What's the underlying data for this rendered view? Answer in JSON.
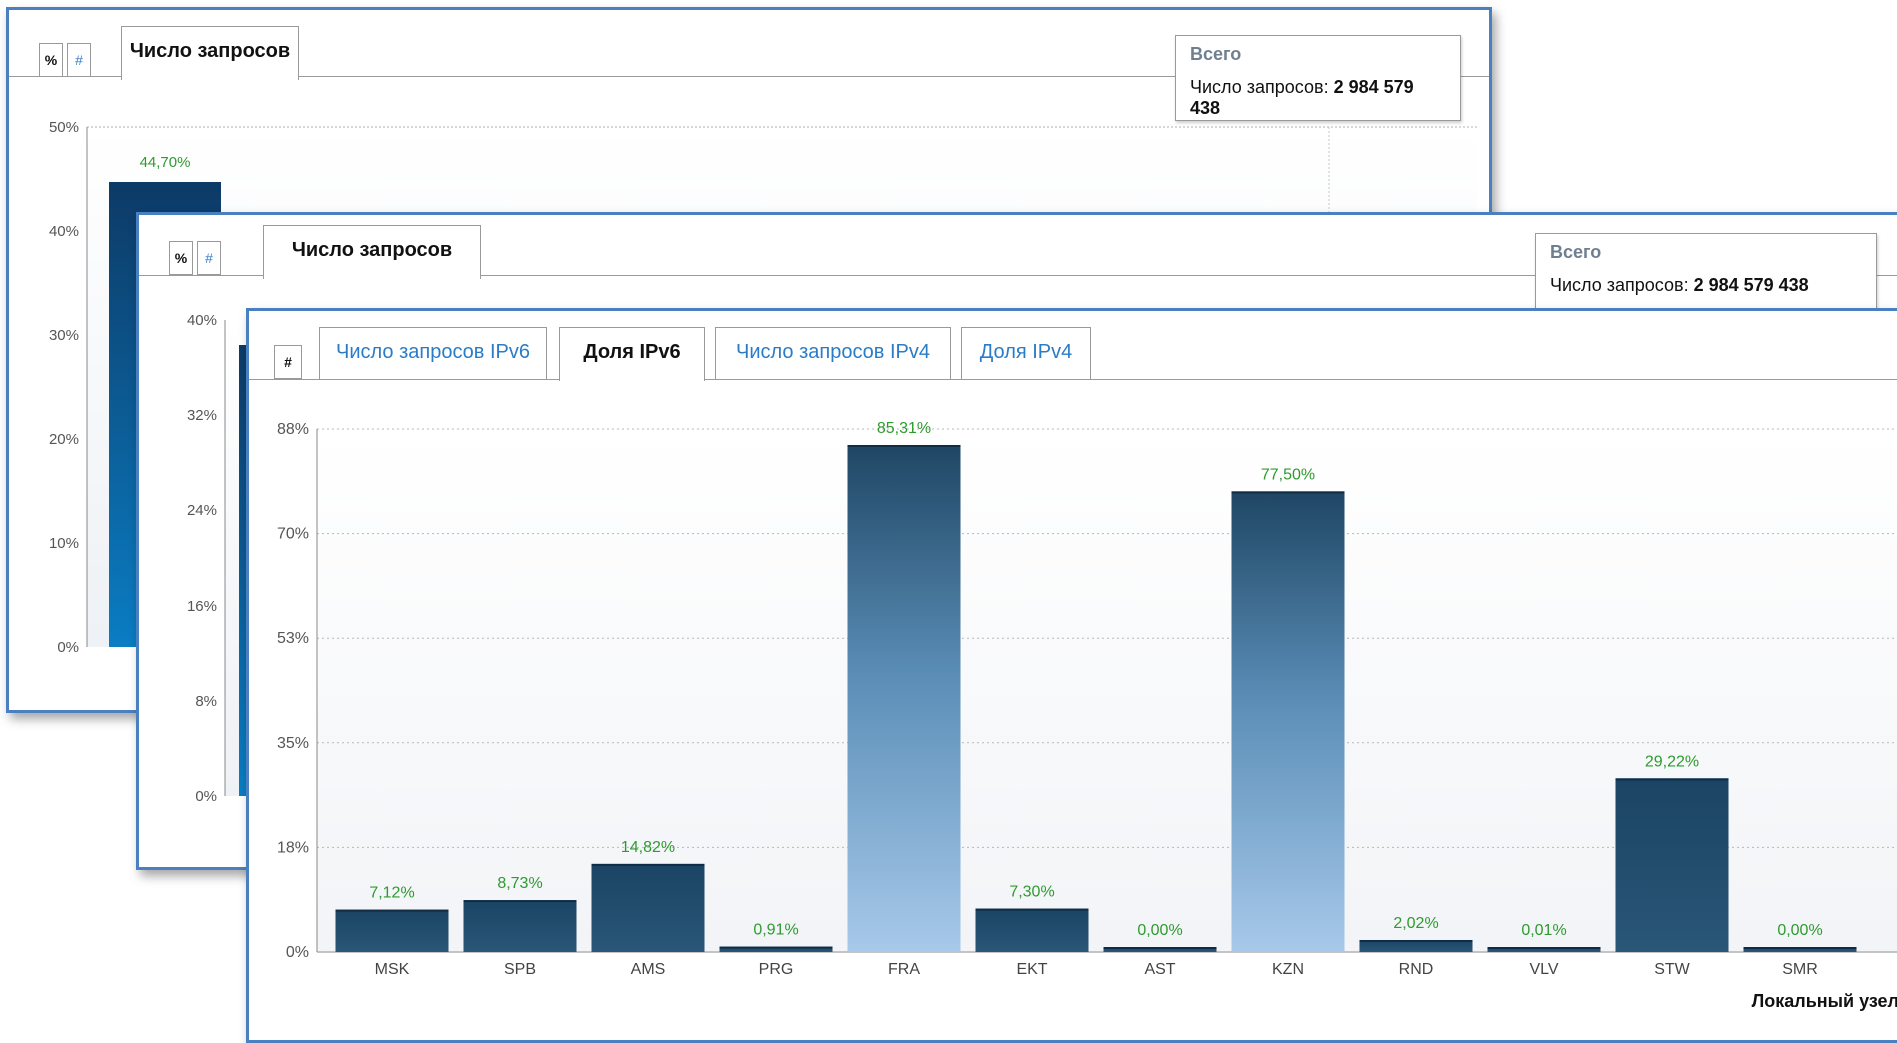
{
  "panels": {
    "back": {
      "mode_buttons": [
        "%",
        "#"
      ],
      "tab_label": "Число запросов",
      "summary": {
        "title": "Всего",
        "label": "Число запросов: ",
        "value": "2 984 579 438"
      },
      "y_ticks": [
        "50%",
        "40%",
        "30%",
        "20%",
        "10%",
        "0%"
      ],
      "bar_label": "44,70%"
    },
    "mid": {
      "mode_buttons": [
        "%",
        "#"
      ],
      "tab_label": "Число запросов",
      "summary": {
        "title": "Всего",
        "label": "Число запросов: ",
        "value": "2 984 579 438"
      },
      "y_ticks": [
        "40%",
        "32%",
        "24%",
        "16%",
        "8%",
        "0%"
      ]
    },
    "front": {
      "mode_button": "#",
      "tabs": [
        "Число запросов IPv6",
        "Доля IPv6",
        "Число запросов IPv4",
        "Доля IPv4"
      ],
      "active_tab": 1,
      "x_axis_title": "Локальный узел"
    }
  },
  "colors": {
    "panel_border": "#4a7fc0",
    "bar_dark": "#1f4664",
    "bar_light": "#a7c9ea",
    "value_label": "#2e9b2e",
    "tab_link": "#2a7cc7"
  },
  "chart_data": {
    "type": "bar",
    "categories": [
      "MSK",
      "SPB",
      "AMS",
      "PRG",
      "FRA",
      "EKT",
      "AST",
      "KZN",
      "RND",
      "VLV",
      "STW",
      "SMR"
    ],
    "values": [
      7.12,
      8.73,
      14.82,
      0.91,
      85.31,
      7.3,
      0.0,
      77.5,
      2.02,
      0.01,
      29.22,
      0.0
    ],
    "value_labels": [
      "7,12%",
      "8,73%",
      "14,82%",
      "0,91%",
      "85,31%",
      "7,30%",
      "0,00%",
      "77,50%",
      "2,02%",
      "0,01%",
      "29,22%",
      "0,00%"
    ],
    "y_ticks": [
      "88%",
      "70%",
      "53%",
      "35%",
      "18%",
      "0%"
    ],
    "ylim": [
      0,
      88
    ],
    "xlabel": "Локальный узел",
    "ylabel": "",
    "grid": true
  }
}
